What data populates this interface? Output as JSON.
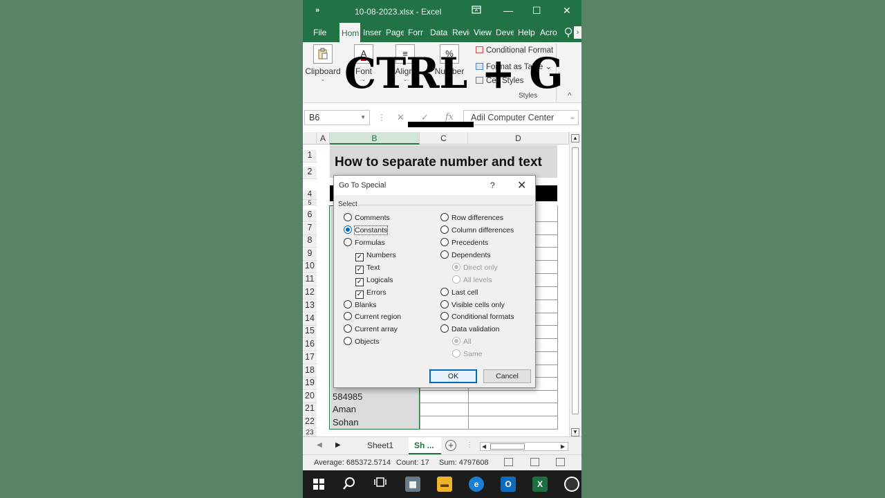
{
  "window": {
    "qat": "»",
    "title": "10-08-2023.xlsx  -  Excel",
    "restore_icon": "ribbon-display-icon",
    "minimize": "—",
    "maximize": "☐",
    "close": "✕"
  },
  "tabs": [
    "File",
    "Hom",
    "Inser",
    "Page",
    "Forr",
    "Data",
    "Revie",
    "View",
    "Deve",
    "Help",
    "Acro"
  ],
  "ribbon": {
    "clipboard": "Clipboard",
    "font": "Font",
    "alignment": "Aligni",
    "number": "Number",
    "conditional_formatting": "Conditional Format",
    "format_as_table": "Format as Table",
    "cell_styles": "Cell Styles",
    "styles_group": "Styles"
  },
  "formula_bar": {
    "name_box": "B6",
    "fx": "fx",
    "content": "Adil Computer Center"
  },
  "grid": {
    "columns": [
      "A",
      "B",
      "C",
      "D"
    ],
    "rows": [
      "1",
      "2",
      "4",
      "5",
      "6",
      "7",
      "8",
      "9",
      "10",
      "11",
      "12",
      "13",
      "14",
      "15",
      "16",
      "17",
      "18",
      "19",
      "20",
      "21",
      "22",
      "23"
    ],
    "title_cell": "How to separate number and text",
    "visible_cells": [
      "584985",
      "Aman",
      "Sohan"
    ]
  },
  "overlay": {
    "shortcut": "CTRL + G"
  },
  "dialog": {
    "title": "Go To Special",
    "help": "?",
    "close": "✕",
    "select_label": "Select",
    "left_options": [
      "Comments",
      "Constants",
      "Formulas",
      "Numbers",
      "Text",
      "Logicals",
      "Errors",
      "Blanks",
      "Current region",
      "Current array",
      "Objects"
    ],
    "right_options": [
      "Row differences",
      "Column differences",
      "Precedents",
      "Dependents",
      "Direct only",
      "All levels",
      "Last cell",
      "Visible cells only",
      "Conditional formats",
      "Data validation",
      "All",
      "Same"
    ],
    "selected": "Constants",
    "ok": "OK",
    "cancel": "Cancel"
  },
  "sheets": {
    "sheet1": "Sheet1",
    "sheet2": "Sh ...",
    "add": "+"
  },
  "status": {
    "average": "Average: 685372.5714",
    "count": "Count: 17",
    "sum": "Sum: 4797608"
  },
  "taskbar": [
    "windows-start-icon",
    "search-icon",
    "task-view-icon",
    "calculator-icon",
    "file-explorer-icon",
    "edge-icon",
    "outlook-icon",
    "excel-icon",
    "obs-icon"
  ],
  "colors": {
    "excel_green": "#217346",
    "background": "#5b8466",
    "accent_blue": "#0067c0"
  }
}
